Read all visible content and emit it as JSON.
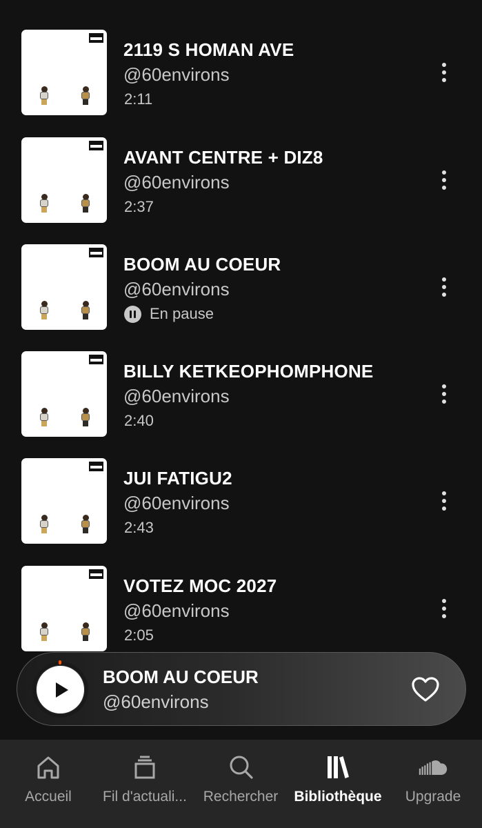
{
  "tracks": [
    {
      "title": "2119 S HOMAN AVE",
      "artist": "@60environs",
      "duration": "2:11"
    },
    {
      "title": "AVANT CENTRE + DIZ8",
      "artist": "@60environs",
      "duration": "2:37"
    },
    {
      "title": "BOOM AU COEUR",
      "artist": "@60environs",
      "status": "En pause"
    },
    {
      "title": "BILLY KETKEOPHOMPHONE",
      "artist": "@60environs",
      "duration": "2:40"
    },
    {
      "title": "JUI FATIGU2",
      "artist": "@60environs",
      "duration": "2:43"
    },
    {
      "title": "VOTEZ MOC 2027",
      "artist": "@60environs",
      "duration": "2:05"
    }
  ],
  "now_playing": {
    "title": "BOOM AU COEUR",
    "artist": "@60environs",
    "state": "paused",
    "progress_accent": "#ff5500"
  },
  "nav": [
    {
      "label": "Accueil",
      "icon": "home-icon",
      "active": false
    },
    {
      "label": "Fil d'actuali...",
      "icon": "feed-icon",
      "active": false
    },
    {
      "label": "Rechercher",
      "icon": "search-icon",
      "active": false
    },
    {
      "label": "Bibliothèque",
      "icon": "library-icon",
      "active": true
    },
    {
      "label": "Upgrade",
      "icon": "soundcloud-icon",
      "active": false
    }
  ],
  "colors": {
    "background": "#121212",
    "nav_background": "#262626",
    "text_primary": "#ffffff",
    "text_secondary": "#c8c8c8",
    "nav_inactive": "#a8a8a8"
  }
}
